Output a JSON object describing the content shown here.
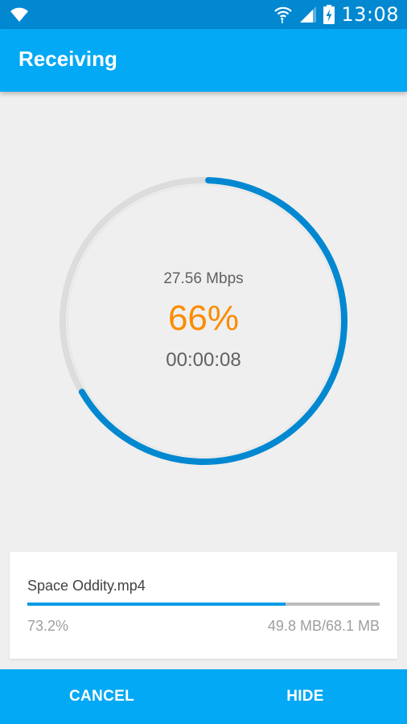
{
  "status_bar": {
    "time": "13:08",
    "icons": [
      "wifi-icon",
      "wifi-transfer-icon",
      "signal-icon",
      "battery-charging-icon"
    ]
  },
  "app_bar": {
    "title": "Receiving"
  },
  "transfer": {
    "speed": "27.56 Mbps",
    "percent_label": "66%",
    "percent_value": 66,
    "elapsed": "00:00:08"
  },
  "file": {
    "name": "Space Oddity.mp4",
    "percent_label": "73.2%",
    "progress": 0.732,
    "size": "49.8 MB/68.1 MB"
  },
  "actions": {
    "cancel_label": "CANCEL",
    "hide_label": "HIDE"
  },
  "colors": {
    "status_bar": "#0288d1",
    "app_bar": "#03a9f4",
    "ring_progress": "#0288d1",
    "ring_track": "#dcdcdc",
    "percent_text": "#fb8c00",
    "background": "#efefef"
  }
}
